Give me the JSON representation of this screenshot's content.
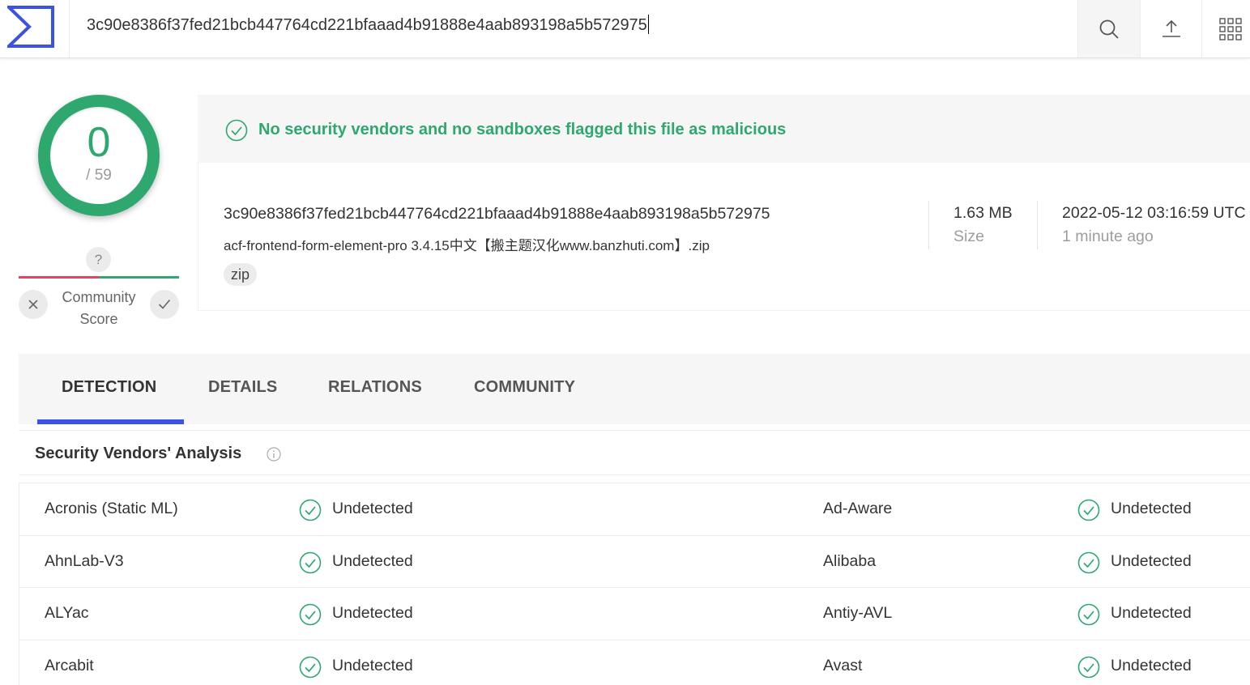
{
  "search": {
    "value": "3c90e8386f37fed21bcb447764cd221bfaaad4b91888e4aab893198a5b572975"
  },
  "score": {
    "detections": "0",
    "total": "/ 59"
  },
  "community": {
    "question": "?",
    "label_line1": "Community",
    "label_line2": "Score"
  },
  "banner": {
    "text": "No security vendors and no sandboxes flagged this file as malicious"
  },
  "file": {
    "hash": "3c90e8386f37fed21bcb447764cd221bfaaad4b91888e4aab893198a5b572975",
    "name": "acf-frontend-form-element-pro 3.4.15中文【搬主题汉化www.banzhuti.com】.zip",
    "tag": "zip",
    "size_value": "1.63 MB",
    "size_label": "Size",
    "date_value": "2022-05-12 03:16:59 UTC",
    "date_label": "1 minute ago"
  },
  "tabs": [
    "DETECTION",
    "DETAILS",
    "RELATIONS",
    "COMMUNITY"
  ],
  "analysis": {
    "title": "Security Vendors' Analysis",
    "rows": [
      {
        "left_vendor": "Acronis (Static ML)",
        "left_status": "Undetected",
        "right_vendor": "Ad-Aware",
        "right_status": "Undetected"
      },
      {
        "left_vendor": "AhnLab-V3",
        "left_status": "Undetected",
        "right_vendor": "Alibaba",
        "right_status": "Undetected"
      },
      {
        "left_vendor": "ALYac",
        "left_status": "Undetected",
        "right_vendor": "Antiy-AVL",
        "right_status": "Undetected"
      },
      {
        "left_vendor": "Arcabit",
        "left_status": "Undetected",
        "right_vendor": "Avast",
        "right_status": "Undetected"
      }
    ]
  },
  "colors": {
    "accent": "#3b52e5",
    "clean": "#2ea86f",
    "malicious": "#e34561"
  }
}
